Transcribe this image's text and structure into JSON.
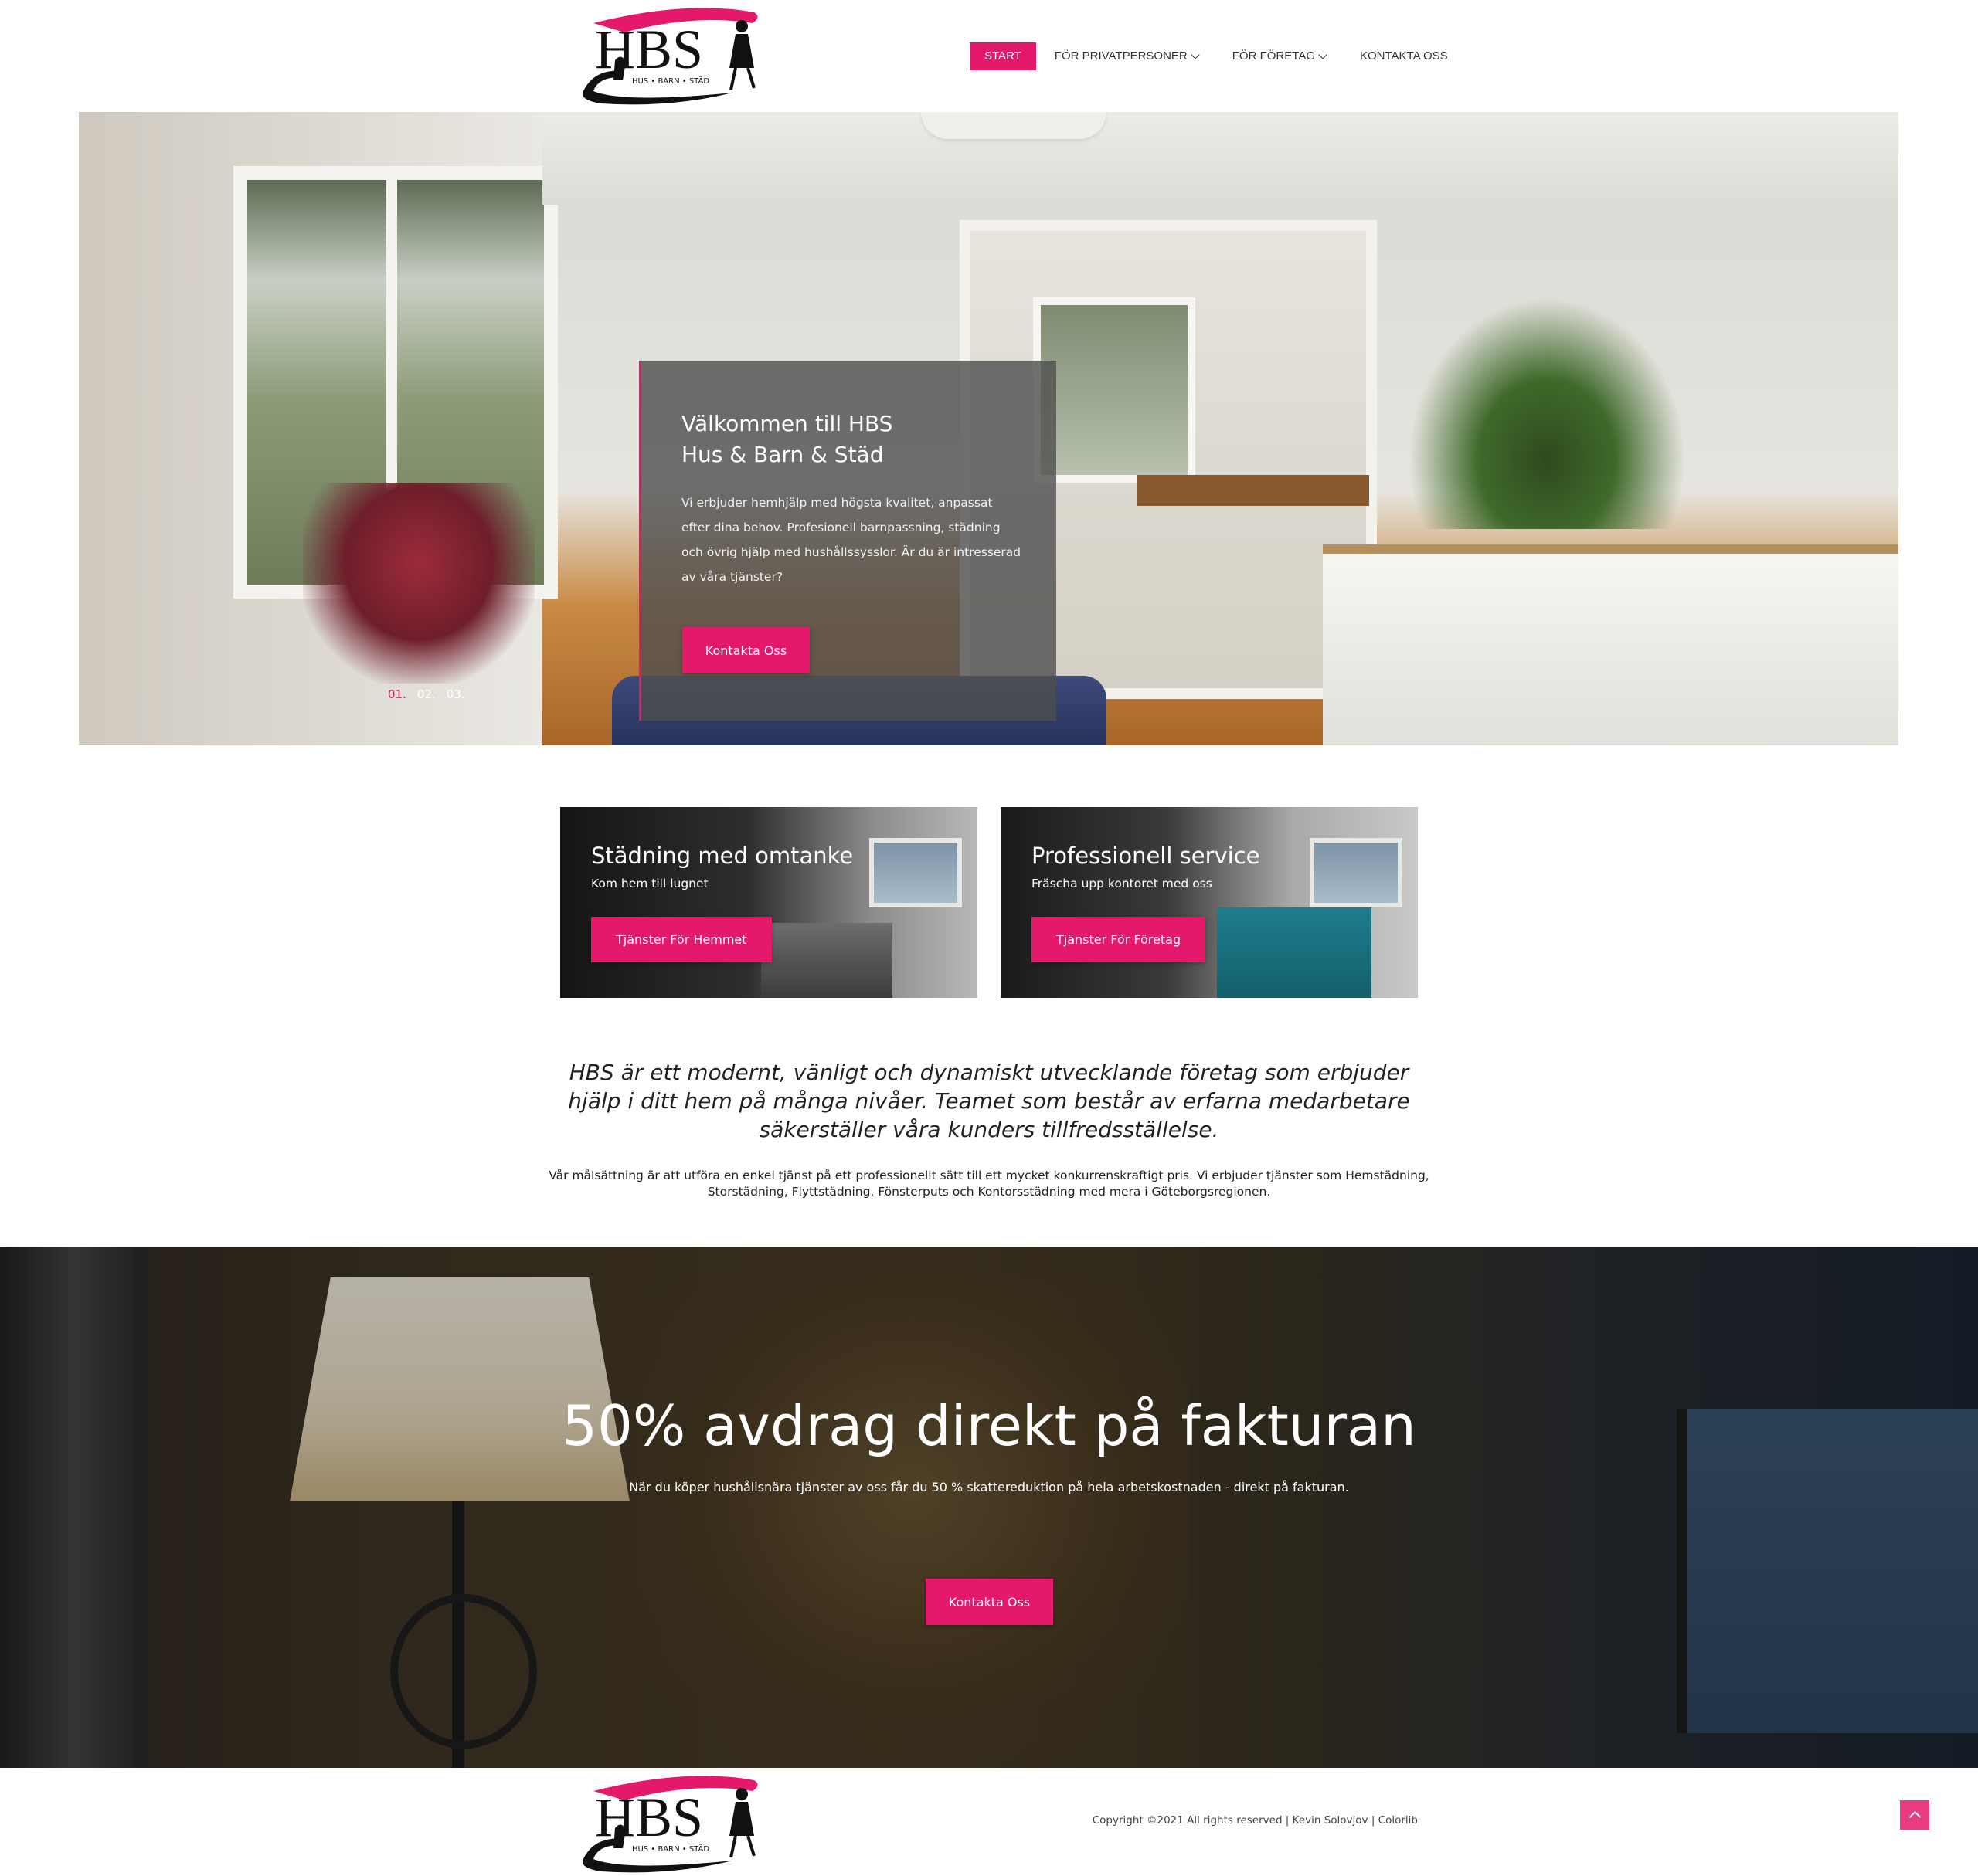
{
  "colors": {
    "accent": "#e5196b",
    "text": "#222222"
  },
  "logo": {
    "main": "HBS",
    "tagline": "HUS • BARN • STÄD"
  },
  "nav": {
    "items": [
      {
        "label": "START",
        "active": true
      },
      {
        "label": "FÖR PRIVATPERSONER",
        "dropdown": true
      },
      {
        "label": "FÖR FÖRETAG",
        "dropdown": true
      },
      {
        "label": "KONTAKTA OSS"
      }
    ]
  },
  "hero": {
    "title": "Välkommen till HBS\nHus & Barn & Städ",
    "text": "Vi erbjuder hemhjälp med högsta kvalitet, anpassat efter dina behov. Profesionell barnpassning, städning och övrig hjälp med hushållssysslor. Är du är intresserad av våra tjänster?",
    "button": "Kontakta Oss",
    "pager": [
      "01.",
      "02.",
      "03."
    ]
  },
  "cards": [
    {
      "title": "Städning med omtanke",
      "subtitle": "Kom hem till lugnet",
      "button": "Tjänster För Hemmet"
    },
    {
      "title": "Professionell service",
      "subtitle": "Fräscha upp kontoret med oss",
      "button": "Tjänster För Företag"
    }
  ],
  "intro": {
    "lead": "HBS är ett modernt, vänligt och dynamiskt utvecklande företag som erbjuder hjälp i ditt hem på många nivåer. Teamet som består av erfarna medarbetare säkerställer våra kunders tillfredsställelse.",
    "body": "Vår målsättning är att utföra en enkel tjänst på ett professionellt sätt till ett mycket konkurrenskraftigt pris. Vi erbjuder tjänster som Hemstädning, Storstädning, Flyttstädning, Fönsterputs och Kontorsstädning med mera i Göteborgsregionen."
  },
  "banner": {
    "title": "50% avdrag direkt på fakturan",
    "text": "När du köper hushållsnära tjänster av oss får du 50 % skattereduktion på hela arbetskostnaden - direkt på fakturan.",
    "button": "Kontakta Oss"
  },
  "footer": {
    "copyright": "Copyright ©2021 All rights reserved | Kevin Solovjov | Colorlib",
    "back_to_top_icon": "chevron-up-icon"
  }
}
